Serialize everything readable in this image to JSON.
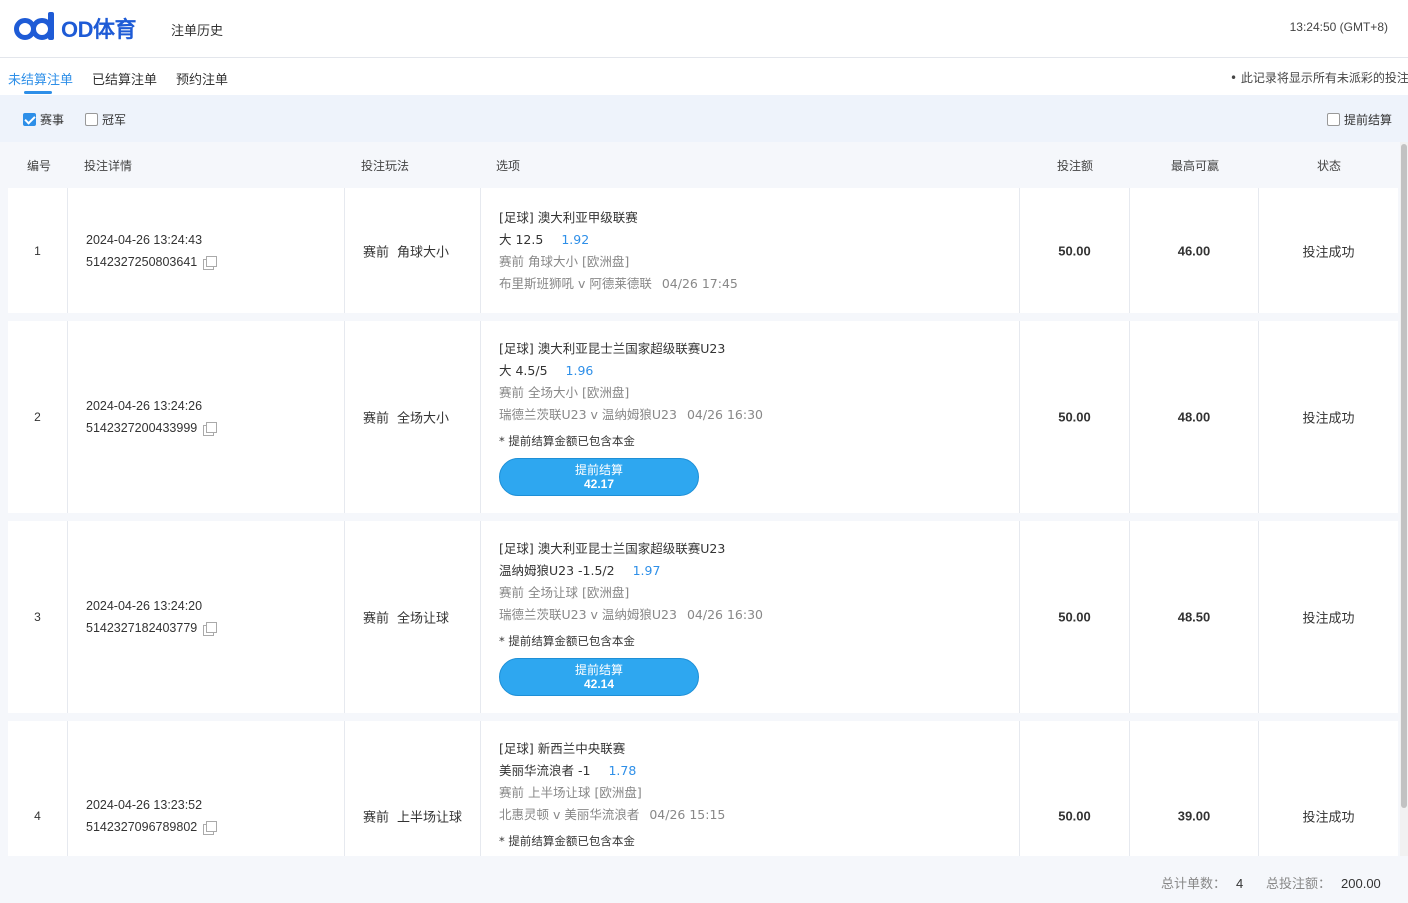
{
  "header": {
    "logo_text": "OD体育",
    "nav_label": "注单历史",
    "time": "13:24:50 (GMT+8)"
  },
  "tabs": [
    {
      "label": "未结算注单",
      "active": true
    },
    {
      "label": "已结算注单",
      "active": false
    },
    {
      "label": "预约注单",
      "active": false
    }
  ],
  "tab_note": "• 此记录将显示所有未派彩的投注",
  "filters": {
    "match": {
      "label": "赛事",
      "checked": true
    },
    "champion": {
      "label": "冠军",
      "checked": false
    },
    "early": {
      "label": "提前结算",
      "checked": false
    }
  },
  "table": {
    "headers": {
      "no": "编号",
      "detail": "投注详情",
      "play": "投注玩法",
      "option": "选项",
      "amount": "投注额",
      "max_win": "最高可赢",
      "status": "状态"
    },
    "rows": [
      {
        "no": "1",
        "datetime": "2024-04-26 13:24:43",
        "bet_id": "5142327250803641",
        "play_stage": "赛前",
        "play_type": "角球大小",
        "league": "[足球] 澳大利亚甲级联赛",
        "selection": "大 12.5",
        "odds": "1.92",
        "market": "赛前 角球大小 [欧洲盘]",
        "match": "布里斯班狮吼 v 阿德莱德联",
        "match_time": "04/26 17:45",
        "amount": "50.00",
        "max_win": "46.00",
        "status": "投注成功"
      },
      {
        "no": "2",
        "datetime": "2024-04-26 13:24:26",
        "bet_id": "5142327200433999",
        "play_stage": "赛前",
        "play_type": "全场大小",
        "league": "[足球] 澳大利亚昆士兰国家超级联赛U23",
        "selection": "大 4.5/5",
        "odds": "1.96",
        "market": "赛前 全场大小 [欧洲盘]",
        "match": "瑞德兰茨联U23 v 温纳姆狼U23",
        "match_time": "04/26 16:30",
        "note": "* 提前结算金额已包含本金",
        "cashout_label": "提前结算",
        "cashout_value": "42.17",
        "amount": "50.00",
        "max_win": "48.00",
        "status": "投注成功"
      },
      {
        "no": "3",
        "datetime": "2024-04-26 13:24:20",
        "bet_id": "5142327182403779",
        "play_stage": "赛前",
        "play_type": "全场让球",
        "league": "[足球] 澳大利亚昆士兰国家超级联赛U23",
        "selection": "温纳姆狼U23 -1.5/2",
        "odds": "1.97",
        "market": "赛前 全场让球 [欧洲盘]",
        "match": "瑞德兰茨联U23 v 温纳姆狼U23",
        "match_time": "04/26 16:30",
        "note": "* 提前结算金额已包含本金",
        "cashout_label": "提前结算",
        "cashout_value": "42.14",
        "amount": "50.00",
        "max_win": "48.50",
        "status": "投注成功"
      },
      {
        "no": "4",
        "datetime": "2024-04-26 13:23:52",
        "bet_id": "5142327096789802",
        "play_stage": "赛前",
        "play_type": "上半场让球",
        "league": "[足球] 新西兰中央联赛",
        "selection": "美丽华流浪者 -1",
        "odds": "1.78",
        "market": "赛前 上半场让球 [欧洲盘]",
        "match": "北惠灵顿 v 美丽华流浪者",
        "match_time": "04/26 15:15",
        "note": "* 提前结算金额已包含本金",
        "amount": "50.00",
        "max_win": "39.00",
        "status": "投注成功"
      }
    ]
  },
  "footer": {
    "count_label": "总计单数：",
    "count_value": "4",
    "total_label": "总投注额：",
    "total_value": "200.00"
  },
  "colors": {
    "accent": "#2e8fe8",
    "brand": "#1e5bd6",
    "cashout_button": "#2ea7f0"
  }
}
